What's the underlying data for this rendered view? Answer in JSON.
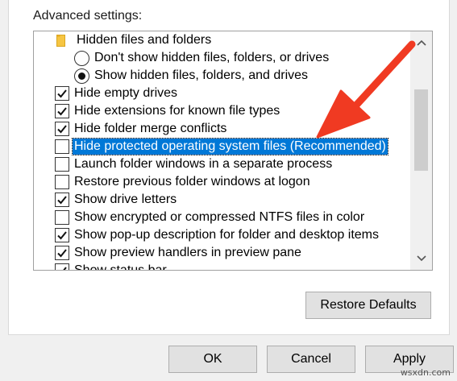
{
  "advanced_settings_label": "Advanced settings:",
  "items": [
    {
      "kind": "folder",
      "icon": "folder-icon",
      "label": "Hidden files and folders"
    },
    {
      "kind": "radio",
      "checked": false,
      "label": "Don't show hidden files, folders, or drives"
    },
    {
      "kind": "radio",
      "checked": true,
      "label": "Show hidden files, folders, and drives"
    },
    {
      "kind": "checkbox",
      "checked": true,
      "label": "Hide empty drives"
    },
    {
      "kind": "checkbox",
      "checked": true,
      "label": "Hide extensions for known file types"
    },
    {
      "kind": "checkbox",
      "checked": true,
      "label": "Hide folder merge conflicts"
    },
    {
      "kind": "checkbox",
      "checked": false,
      "selected": true,
      "label": "Hide protected operating system files (Recommended)"
    },
    {
      "kind": "checkbox",
      "checked": false,
      "label": "Launch folder windows in a separate process"
    },
    {
      "kind": "checkbox",
      "checked": false,
      "label": "Restore previous folder windows at logon"
    },
    {
      "kind": "checkbox",
      "checked": true,
      "label": "Show drive letters"
    },
    {
      "kind": "checkbox",
      "checked": false,
      "label": "Show encrypted or compressed NTFS files in color"
    },
    {
      "kind": "checkbox",
      "checked": true,
      "label": "Show pop-up description for folder and desktop items"
    },
    {
      "kind": "checkbox",
      "checked": true,
      "label": "Show preview handlers in preview pane"
    },
    {
      "kind": "checkbox",
      "checked": true,
      "label": "Show status bar"
    }
  ],
  "buttons": {
    "restore_defaults": "Restore Defaults",
    "ok": "OK",
    "cancel": "Cancel",
    "apply": "Apply"
  },
  "watermark": "wsxdn.com",
  "colors": {
    "selection": "#0078d7",
    "annotation_arrow": "#f03a22"
  }
}
